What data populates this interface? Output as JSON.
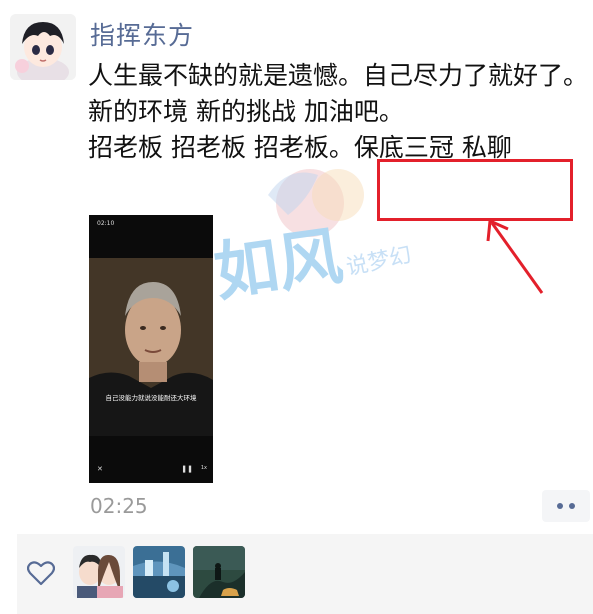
{
  "post": {
    "username": "指挥东方",
    "text_lines": [
      "人生最不缺的就是遗憾。自己尽力了就好了。",
      "新的环境 新的挑战 加油吧。",
      "招老板 招老板 招老板。保底三冠 私聊"
    ],
    "timestamp": "02:25"
  },
  "video": {
    "status_time": "02:10",
    "subtitle": "自己没能力就说没能耐还大环境"
  },
  "watermark": {
    "text_main": "如风",
    "text_sub": "说梦幻"
  },
  "likes": {
    "count_avatars": 3
  },
  "colors": {
    "username": "#576b95",
    "highlight": "#e3202b",
    "likes_bg": "#f5f5f5"
  }
}
